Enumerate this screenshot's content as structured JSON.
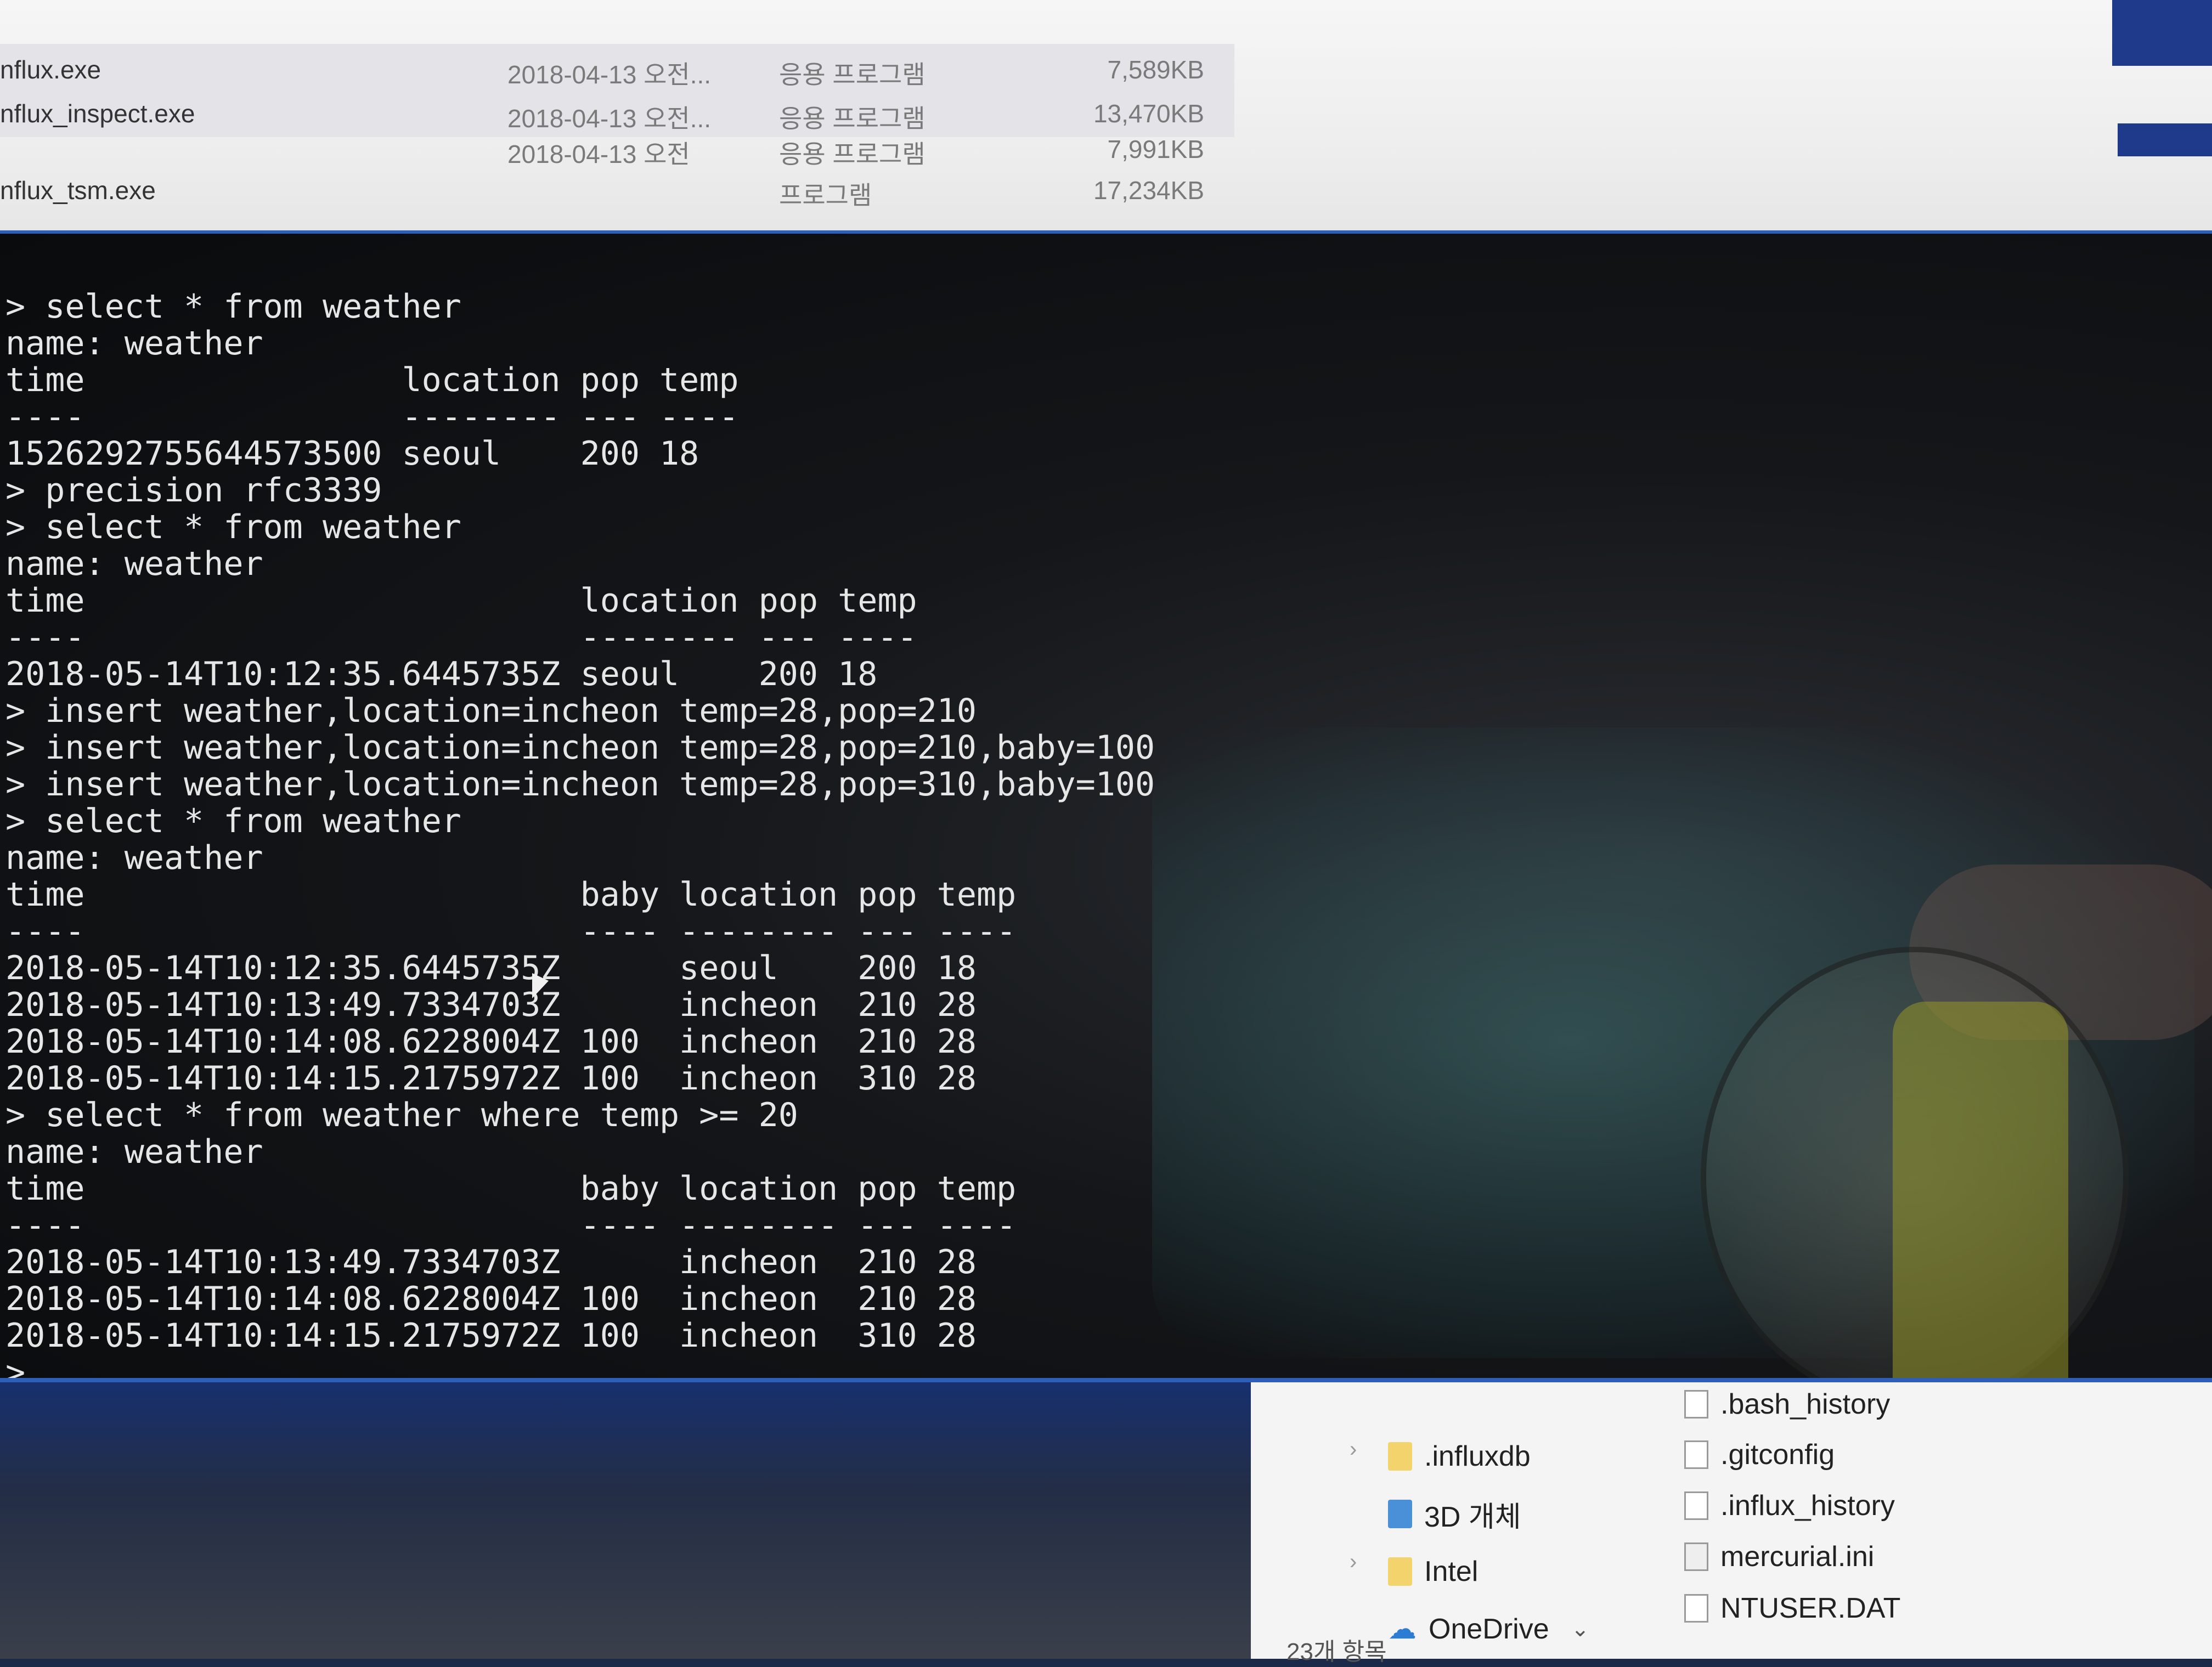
{
  "explorer_top": {
    "rows": [
      {
        "name": "nflux.exe",
        "date": "2018-04-13 오전...",
        "type": "응용 프로그램",
        "size": "7,589KB"
      },
      {
        "name": "nflux_inspect.exe",
        "date": "2018-04-13 오전...",
        "type": "응용 프로그램",
        "size": "13,470KB"
      },
      {
        "name": "",
        "date": "2018-04-13 오전",
        "type": "응용 프로그램",
        "size": "7,991KB"
      },
      {
        "name": "nflux_tsm.exe",
        "date": "",
        "type": "프로그램",
        "size": "17,234KB"
      }
    ]
  },
  "terminal": {
    "lines": [
      "> select * from weather",
      "name: weather",
      "time                location pop temp",
      "----                -------- --- ----",
      "1526292755644573500 seoul    200 18",
      "> precision rfc3339",
      "> select * from weather",
      "name: weather",
      "time                         location pop temp",
      "----                         -------- --- ----",
      "2018-05-14T10:12:35.6445735Z seoul    200 18",
      "> insert weather,location=incheon temp=28,pop=210",
      "> insert weather,location=incheon temp=28,pop=210,baby=100",
      "> insert weather,location=incheon temp=28,pop=310,baby=100",
      "> select * from weather",
      "name: weather",
      "time                         baby location pop temp",
      "----                         ---- -------- --- ----",
      "2018-05-14T10:12:35.6445735Z      seoul    200 18",
      "2018-05-14T10:13:49.7334703Z      incheon  210 28",
      "2018-05-14T10:14:08.6228004Z 100  incheon  210 28",
      "2018-05-14T10:14:15.2175972Z 100  incheon  310 28",
      "> select * from weather where temp >= 20",
      "name: weather",
      "time                         baby location pop temp",
      "----                         ---- -------- --- ----",
      "2018-05-14T10:13:49.7334703Z      incheon  210 28",
      "2018-05-14T10:14:08.6228004Z 100  incheon  210 28",
      "2018-05-14T10:14:15.2175972Z 100  incheon  310 28",
      ">"
    ]
  },
  "explorer_bottom": {
    "tree": [
      {
        "label": ".influxdb",
        "icon": "folder-icon"
      },
      {
        "label": "3D 개체",
        "icon": "3d-objects-icon"
      },
      {
        "label": "Intel",
        "icon": "folder-icon"
      },
      {
        "label": "OneDrive",
        "icon": "cloud-icon"
      }
    ],
    "files": [
      {
        "label": ".bash_history",
        "icon": "file-icon"
      },
      {
        "label": ".gitconfig",
        "icon": "file-icon"
      },
      {
        "label": ".influx_history",
        "icon": "file-icon"
      },
      {
        "label": "mercurial.ini",
        "icon": "settings-file-icon"
      },
      {
        "label": "NTUSER.DAT",
        "icon": "file-icon"
      }
    ],
    "item_count": "23개 항목"
  },
  "colors": {
    "terminal_bg": "#0a0b0d",
    "terminal_text": "#e6e6e6",
    "accent_blue": "#2d5fb8"
  }
}
